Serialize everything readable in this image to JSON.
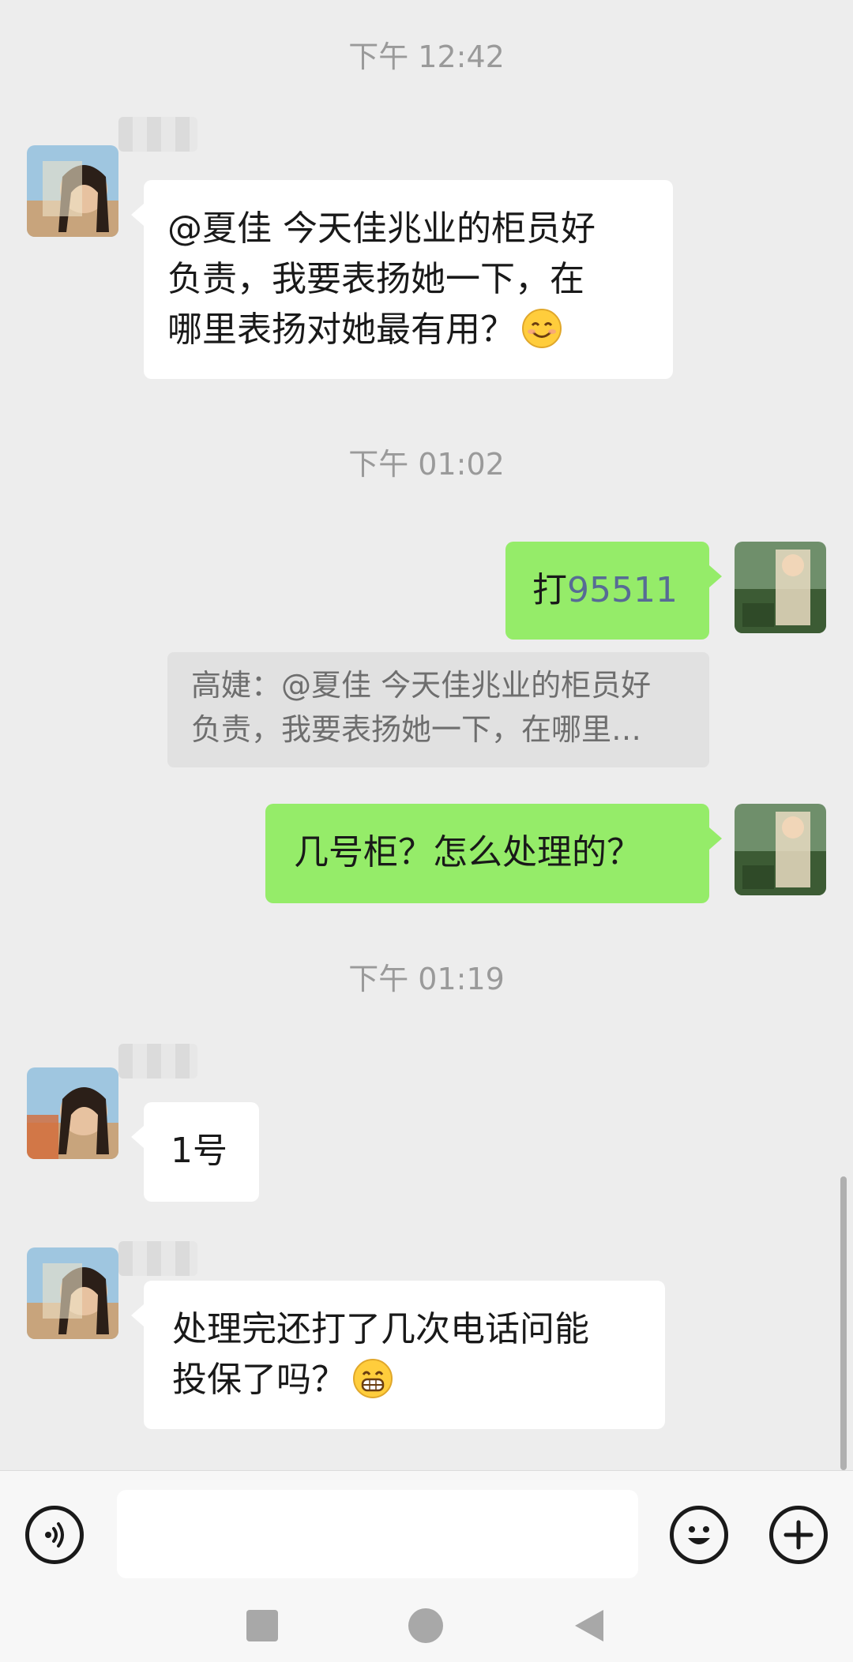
{
  "timestamps": [
    "下午 12:42",
    "下午 01:02",
    "下午 01:19"
  ],
  "messages": {
    "m1": {
      "lines": [
        "@夏佳 今天佳兆业的柜员好",
        "负责，我要表扬她一下，在",
        "哪里表扬对她最有用？"
      ],
      "emoji": "smile-emoji"
    },
    "m2": {
      "prefix": "打",
      "link": "95511"
    },
    "quote": {
      "lines": [
        "高婕：@夏佳 今天佳兆业的柜员好",
        "负责，我要表扬她一下，在哪里…"
      ]
    },
    "m3": {
      "text": "几号柜？怎么处理的？"
    },
    "m4": {
      "text": "1号"
    },
    "m5": {
      "lines": [
        "处理完还打了几次电话问能",
        "投保了吗？"
      ],
      "emoji": "grin-emoji"
    }
  },
  "input": {
    "placeholder": ""
  },
  "icons": {
    "voice": "voice-icon",
    "emoji": "emoji-icon",
    "plus": "plus-icon",
    "nav_recent": "square-icon",
    "nav_home": "circle-icon",
    "nav_back": "triangle-back-icon"
  },
  "colors": {
    "background": "#ededed",
    "outgoing_bubble": "#95ec69",
    "incoming_bubble": "#ffffff",
    "link": "#576b95",
    "timestamp": "#9a9a9a"
  }
}
